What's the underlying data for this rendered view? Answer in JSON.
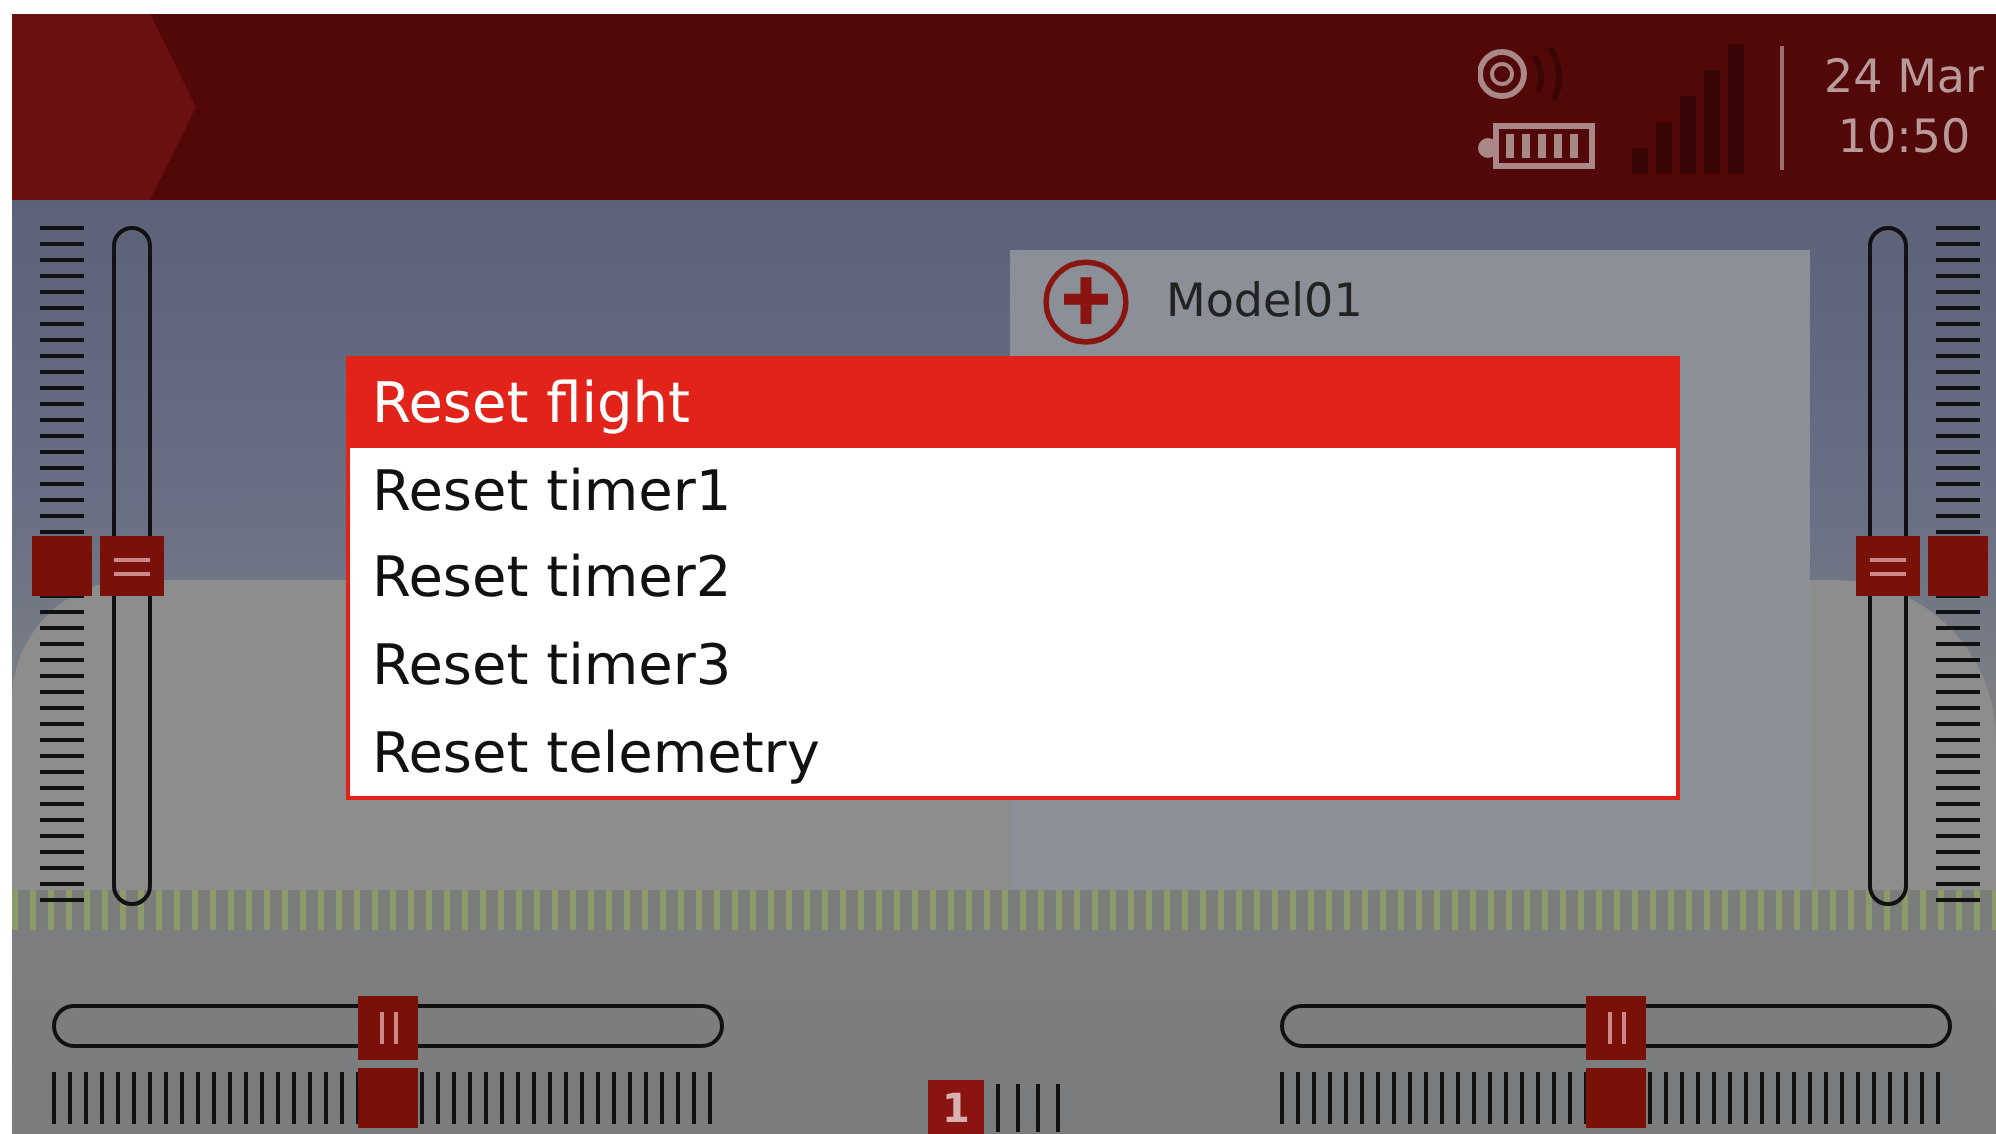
{
  "header": {
    "date": "24 Mar",
    "time": "10:50"
  },
  "model": {
    "name": "Model01"
  },
  "trims": {
    "left_vertical": {
      "level": 0.5
    },
    "right_vertical": {
      "level": 0.5
    },
    "left_horizontal": {
      "level": 0.5
    },
    "right_horizontal": {
      "level": 0.5
    }
  },
  "flight_mode": {
    "number": "1"
  },
  "menu": {
    "items": [
      {
        "label": "Reset flight",
        "selected": true
      },
      {
        "label": "Reset timer1",
        "selected": false
      },
      {
        "label": "Reset timer2",
        "selected": false
      },
      {
        "label": "Reset timer3",
        "selected": false
      },
      {
        "label": "Reset telemetry",
        "selected": false
      }
    ]
  }
}
